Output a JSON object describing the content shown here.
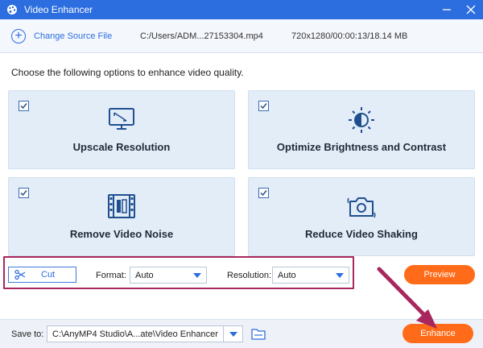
{
  "window": {
    "title": "Video Enhancer"
  },
  "file": {
    "change_label": "Change Source File",
    "path": "C:/Users/ADM...27153304.mp4",
    "meta": "720x1280/00:00:13/18.14 MB"
  },
  "instruction": "Choose the following options to enhance video quality.",
  "options": [
    {
      "label": "Upscale Resolution",
      "checked": true,
      "icon": "monitor-icon"
    },
    {
      "label": "Optimize Brightness and Contrast",
      "checked": true,
      "icon": "brightness-icon"
    },
    {
      "label": "Remove Video Noise",
      "checked": true,
      "icon": "film-icon"
    },
    {
      "label": "Reduce Video Shaking",
      "checked": true,
      "icon": "camera-shake-icon"
    }
  ],
  "toolbar": {
    "cut_label": "Cut",
    "format_label": "Format:",
    "format_value": "Auto",
    "resolution_label": "Resolution:",
    "resolution_value": "Auto",
    "preview_label": "Preview"
  },
  "bottom": {
    "save_label": "Save to:",
    "save_path": "C:\\AnyMP4 Studio\\A...ate\\Video Enhancer",
    "enhance_label": "Enhance"
  },
  "colors": {
    "title_bar": "#2c6de0",
    "accent_orange": "#ff6b18",
    "card_bg": "#e3edf8",
    "highlight_box": "#a8275d"
  }
}
